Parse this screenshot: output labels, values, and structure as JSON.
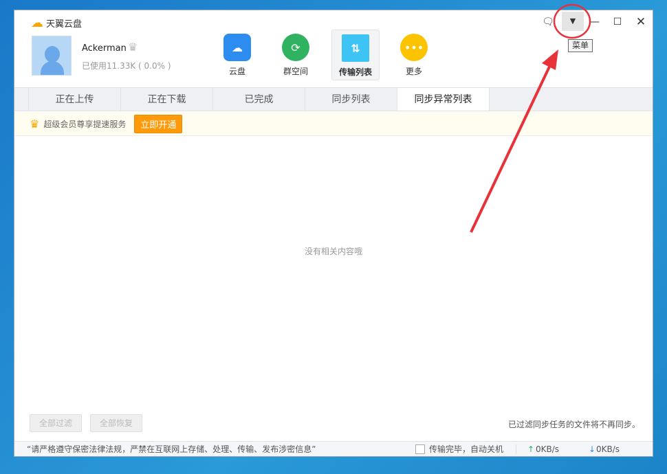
{
  "app": {
    "title": "天翼云盘"
  },
  "user": {
    "name": "Ackerman",
    "usage": "已使用11.33K ( 0.0% )"
  },
  "nav": [
    {
      "label": "云盘"
    },
    {
      "label": "群空间"
    },
    {
      "label": "传输列表"
    },
    {
      "label": "更多"
    }
  ],
  "tooltip": "菜单",
  "tabs": [
    {
      "label": "正在上传"
    },
    {
      "label": "正在下载"
    },
    {
      "label": "已完成"
    },
    {
      "label": "同步列表"
    },
    {
      "label": "同步异常列表"
    }
  ],
  "promo": {
    "text": "超级会员尊享提速服务",
    "button": "立即开通"
  },
  "empty_text": "没有相关内容哦",
  "buttons": {
    "filter_all": "全部过滤",
    "restore_all": "全部恢复"
  },
  "note": "已过滤同步任务的文件将不再同步。",
  "status": {
    "notice": "“请严格遵守保密法律法规，严禁在互联网上存储、处理、传输、发布涉密信息”",
    "shutdown": "传输完毕，自动关机",
    "upload_speed": "0KB/s",
    "download_speed": "0KB/s"
  }
}
